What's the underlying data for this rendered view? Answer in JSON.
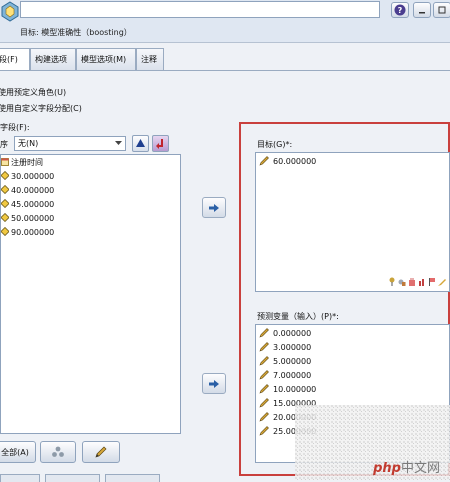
{
  "header": {
    "name_value": "",
    "subtitle": "目标: 模型准确性（boosting）",
    "buttons": [
      {
        "icon": "help-icon",
        "color": "#4a3d8f"
      },
      {
        "icon": "minimize-icon"
      },
      {
        "icon": "restore-icon"
      }
    ]
  },
  "tabs": [
    {
      "label": "字段(F)",
      "active": true
    },
    {
      "label": "构建选项",
      "active": false
    },
    {
      "label": "模型选项(M)",
      "active": false
    },
    {
      "label": "注释",
      "active": false
    }
  ],
  "role_options": [
    {
      "label": "使用预定义角色(U)"
    },
    {
      "label": "使用自定义字段分配(C)"
    }
  ],
  "fields_panel": {
    "label": "字段(F):",
    "sort_label": "序",
    "sort_value": "无(N)",
    "items": [
      {
        "label": "注册时间",
        "type": "date"
      },
      {
        "label": "30.000000",
        "type": "continuous"
      },
      {
        "label": "40.000000",
        "type": "continuous"
      },
      {
        "label": "45.000000",
        "type": "continuous"
      },
      {
        "label": "50.000000",
        "type": "continuous"
      },
      {
        "label": "90.000000",
        "type": "continuous"
      }
    ]
  },
  "bottom_buttons": {
    "all_label": "全部(A)"
  },
  "target_panel": {
    "label": "目标(G)*:",
    "items": [
      {
        "label": "60.000000"
      }
    ]
  },
  "predictor_panel": {
    "label": "预测变量（输入）(P)*:",
    "items": [
      {
        "label": "0.000000"
      },
      {
        "label": "3.000000"
      },
      {
        "label": "5.000000"
      },
      {
        "label": "7.000000"
      },
      {
        "label": "10.000000"
      },
      {
        "label": "15.000000"
      },
      {
        "label": "20.000000"
      },
      {
        "label": "25.000000"
      }
    ]
  },
  "watermark": {
    "logo": "php",
    "text": "中文网"
  },
  "colors": {
    "highlight_border": "#c9403d",
    "accent_blue": "#1f4fa3",
    "pencil": "#b48a2c"
  }
}
